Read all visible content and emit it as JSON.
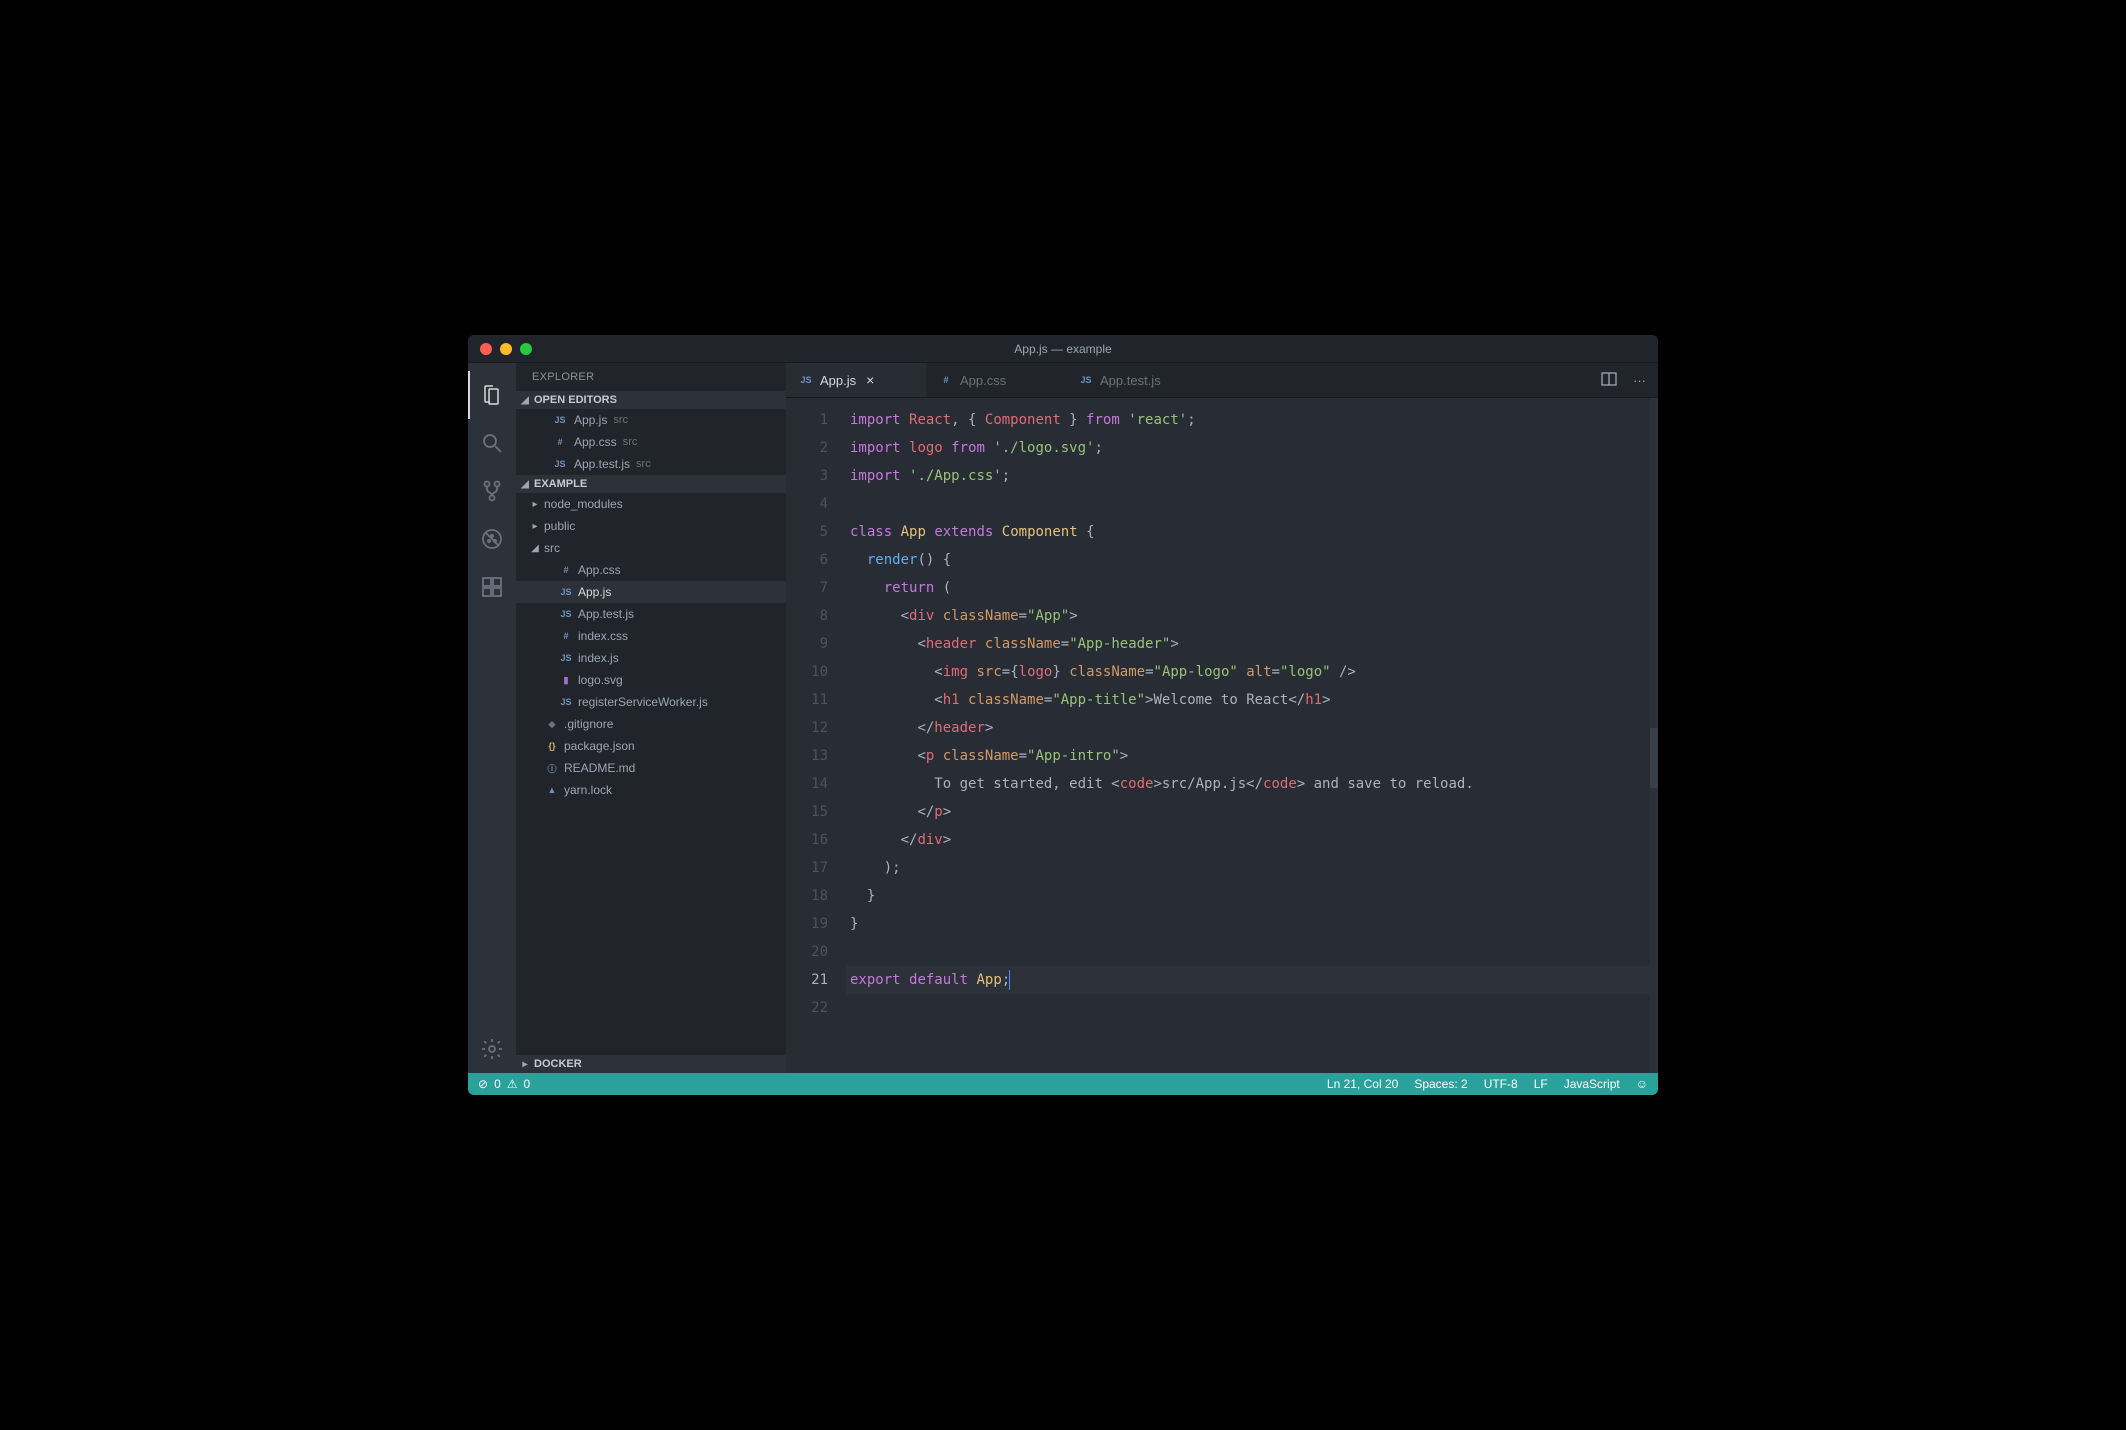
{
  "window": {
    "title": "App.js — example"
  },
  "sidebar": {
    "title": "EXPLORER",
    "sections": {
      "openEditors": {
        "label": "OPEN EDITORS"
      },
      "project": {
        "label": "EXAMPLE"
      },
      "docker": {
        "label": "DOCKER"
      }
    }
  },
  "openEditors": [
    {
      "icon": "JS",
      "name": "App.js",
      "meta": "src"
    },
    {
      "icon": "#",
      "name": "App.css",
      "meta": "src"
    },
    {
      "icon": "JS",
      "name": "App.test.js",
      "meta": "src"
    }
  ],
  "tree": [
    {
      "type": "folder",
      "name": "node_modules",
      "depth": 1,
      "expanded": false
    },
    {
      "type": "folder",
      "name": "public",
      "depth": 1,
      "expanded": false
    },
    {
      "type": "folder",
      "name": "src",
      "depth": 1,
      "expanded": true
    },
    {
      "type": "file",
      "icon": "#",
      "name": "App.css",
      "depth": 2
    },
    {
      "type": "file",
      "icon": "JS",
      "name": "App.js",
      "depth": 2,
      "active": true
    },
    {
      "type": "file",
      "icon": "JS",
      "name": "App.test.js",
      "depth": 2
    },
    {
      "type": "file",
      "icon": "#",
      "name": "index.css",
      "depth": 2
    },
    {
      "type": "file",
      "icon": "JS",
      "name": "index.js",
      "depth": 2
    },
    {
      "type": "file",
      "icon": "▮",
      "iconClass": "svg",
      "name": "logo.svg",
      "depth": 2
    },
    {
      "type": "file",
      "icon": "JS",
      "name": "registerServiceWorker.js",
      "depth": 2
    },
    {
      "type": "file",
      "icon": "◆",
      "iconClass": "git",
      "name": ".gitignore",
      "depth": 1
    },
    {
      "type": "file",
      "icon": "{}",
      "iconClass": "json",
      "name": "package.json",
      "depth": 1
    },
    {
      "type": "file",
      "icon": "ⓘ",
      "iconClass": "info",
      "name": "README.md",
      "depth": 1
    },
    {
      "type": "file",
      "icon": "▲",
      "iconClass": "lock",
      "name": "yarn.lock",
      "depth": 1
    }
  ],
  "tabs": [
    {
      "icon": "JS",
      "label": "App.js",
      "active": true,
      "close": true
    },
    {
      "icon": "#",
      "label": "App.css",
      "active": false,
      "close": false
    },
    {
      "icon": "JS",
      "label": "App.test.js",
      "active": false,
      "close": false
    }
  ],
  "code": {
    "cursorLine": 21,
    "lines": [
      {
        "n": 1,
        "t": [
          [
            "k-purple",
            "import"
          ],
          [
            "k-gray",
            " "
          ],
          [
            "k-red",
            "React"
          ],
          [
            "k-gray",
            ", "
          ],
          [
            "k-gray",
            "{ "
          ],
          [
            "k-red",
            "Component"
          ],
          [
            "k-gray",
            " } "
          ],
          [
            "k-purple",
            "from"
          ],
          [
            "k-gray",
            " "
          ],
          [
            "k-green",
            "'react'"
          ],
          [
            "k-gray",
            ";"
          ]
        ]
      },
      {
        "n": 2,
        "t": [
          [
            "k-purple",
            "import"
          ],
          [
            "k-gray",
            " "
          ],
          [
            "k-red",
            "logo"
          ],
          [
            "k-gray",
            " "
          ],
          [
            "k-purple",
            "from"
          ],
          [
            "k-gray",
            " "
          ],
          [
            "k-green",
            "'./logo.svg'"
          ],
          [
            "k-gray",
            ";"
          ]
        ]
      },
      {
        "n": 3,
        "t": [
          [
            "k-purple",
            "import"
          ],
          [
            "k-gray",
            " "
          ],
          [
            "k-green",
            "'./App.css'"
          ],
          [
            "k-gray",
            ";"
          ]
        ]
      },
      {
        "n": 4,
        "t": []
      },
      {
        "n": 5,
        "t": [
          [
            "k-purple",
            "class"
          ],
          [
            "k-gray",
            " "
          ],
          [
            "k-yellow",
            "App"
          ],
          [
            "k-gray",
            " "
          ],
          [
            "k-purple",
            "extends"
          ],
          [
            "k-gray",
            " "
          ],
          [
            "k-yellow",
            "Component"
          ],
          [
            "k-gray",
            " {"
          ]
        ]
      },
      {
        "n": 6,
        "i": 1,
        "t": [
          [
            "k-blue",
            "render"
          ],
          [
            "k-gray",
            "() {"
          ]
        ]
      },
      {
        "n": 7,
        "i": 2,
        "t": [
          [
            "k-purple",
            "return"
          ],
          [
            "k-gray",
            " ("
          ]
        ]
      },
      {
        "n": 8,
        "i": 3,
        "t": [
          [
            "k-gray",
            "<"
          ],
          [
            "k-red",
            "div"
          ],
          [
            "k-gray",
            " "
          ],
          [
            "k-orange",
            "className"
          ],
          [
            "k-gray",
            "="
          ],
          [
            "k-green",
            "\"App\""
          ],
          [
            "k-gray",
            ">"
          ]
        ]
      },
      {
        "n": 9,
        "i": 4,
        "t": [
          [
            "k-gray",
            "<"
          ],
          [
            "k-red",
            "header"
          ],
          [
            "k-gray",
            " "
          ],
          [
            "k-orange",
            "className"
          ],
          [
            "k-gray",
            "="
          ],
          [
            "k-green",
            "\"App-header\""
          ],
          [
            "k-gray",
            ">"
          ]
        ]
      },
      {
        "n": 10,
        "i": 5,
        "t": [
          [
            "k-gray",
            "<"
          ],
          [
            "k-red",
            "img"
          ],
          [
            "k-gray",
            " "
          ],
          [
            "k-orange",
            "src"
          ],
          [
            "k-gray",
            "="
          ],
          [
            "k-gray",
            "{"
          ],
          [
            "k-red",
            "logo"
          ],
          [
            "k-gray",
            "} "
          ],
          [
            "k-orange",
            "className"
          ],
          [
            "k-gray",
            "="
          ],
          [
            "k-green",
            "\"App-logo\""
          ],
          [
            "k-gray",
            " "
          ],
          [
            "k-orange",
            "alt"
          ],
          [
            "k-gray",
            "="
          ],
          [
            "k-green",
            "\"logo\""
          ],
          [
            "k-gray",
            " />"
          ]
        ]
      },
      {
        "n": 11,
        "i": 5,
        "t": [
          [
            "k-gray",
            "<"
          ],
          [
            "k-red",
            "h1"
          ],
          [
            "k-gray",
            " "
          ],
          [
            "k-orange",
            "className"
          ],
          [
            "k-gray",
            "="
          ],
          [
            "k-green",
            "\"App-title\""
          ],
          [
            "k-gray",
            ">"
          ],
          [
            "k-gray",
            "Welcome to React"
          ],
          [
            "k-gray",
            "</"
          ],
          [
            "k-red",
            "h1"
          ],
          [
            "k-gray",
            ">"
          ]
        ]
      },
      {
        "n": 12,
        "i": 4,
        "t": [
          [
            "k-gray",
            "</"
          ],
          [
            "k-red",
            "header"
          ],
          [
            "k-gray",
            ">"
          ]
        ]
      },
      {
        "n": 13,
        "i": 4,
        "t": [
          [
            "k-gray",
            "<"
          ],
          [
            "k-red",
            "p"
          ],
          [
            "k-gray",
            " "
          ],
          [
            "k-orange",
            "className"
          ],
          [
            "k-gray",
            "="
          ],
          [
            "k-green",
            "\"App-intro\""
          ],
          [
            "k-gray",
            ">"
          ]
        ]
      },
      {
        "n": 14,
        "i": 5,
        "t": [
          [
            "k-gray",
            "To get started, edit <"
          ],
          [
            "k-red",
            "code"
          ],
          [
            "k-gray",
            ">src/App.js</"
          ],
          [
            "k-red",
            "code"
          ],
          [
            "k-gray",
            "> and save to reload."
          ]
        ]
      },
      {
        "n": 15,
        "i": 4,
        "t": [
          [
            "k-gray",
            "</"
          ],
          [
            "k-red",
            "p"
          ],
          [
            "k-gray",
            ">"
          ]
        ]
      },
      {
        "n": 16,
        "i": 3,
        "t": [
          [
            "k-gray",
            "</"
          ],
          [
            "k-red",
            "div"
          ],
          [
            "k-gray",
            ">"
          ]
        ]
      },
      {
        "n": 17,
        "i": 2,
        "t": [
          [
            "k-gray",
            ");"
          ]
        ]
      },
      {
        "n": 18,
        "i": 1,
        "t": [
          [
            "k-gray",
            "}"
          ]
        ]
      },
      {
        "n": 19,
        "t": [
          [
            "k-gray",
            "}"
          ]
        ]
      },
      {
        "n": 20,
        "t": []
      },
      {
        "n": 21,
        "hl": true,
        "t": [
          [
            "k-purple",
            "export"
          ],
          [
            "k-gray",
            " "
          ],
          [
            "k-purple",
            "default"
          ],
          [
            "k-gray",
            " "
          ],
          [
            "k-yellow",
            "App"
          ],
          [
            "k-gray",
            ";"
          ]
        ],
        "cursor": true
      },
      {
        "n": 22,
        "t": []
      }
    ]
  },
  "status": {
    "errors": "0",
    "warnings": "0",
    "cursor": "Ln 21, Col 20",
    "spaces": "Spaces: 2",
    "encoding": "UTF-8",
    "eol": "LF",
    "lang": "JavaScript"
  }
}
